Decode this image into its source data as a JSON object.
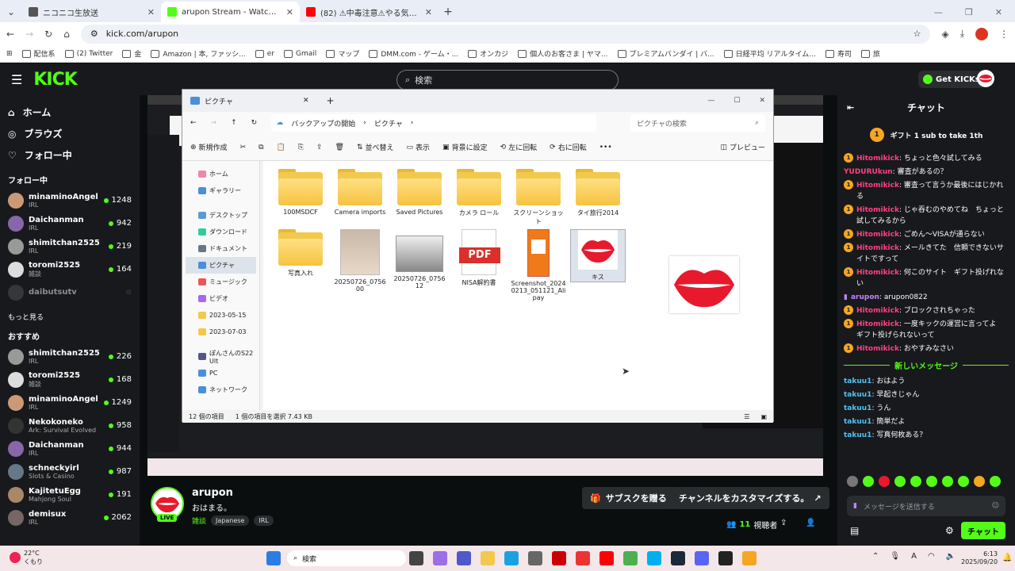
{
  "browser": {
    "tabs": [
      {
        "title": "ニコニコ生放送",
        "color": "#555"
      },
      {
        "title": "arupon Stream - Watch Live on",
        "color": "#53fc18"
      },
      {
        "title": "(82) ⚠中毒注意⚠やる気が⚠",
        "color": "#ff0000"
      }
    ],
    "url": "kick.com/arupon",
    "bookmarks": [
      "配信系",
      "(2) Twitter",
      "金",
      "Amazon | 本, ファッシ...",
      "er",
      "Gmail",
      "マップ",
      "DMM.com - ゲーム・...",
      "オンカジ",
      "個人のお客さま | ヤマ...",
      "プレミアムバンダイ | バ...",
      "日経平均 リアルタイム...",
      "寿司",
      "旅"
    ]
  },
  "kick": {
    "logo": "KICK",
    "search_placeholder": "検索",
    "get_kicks": "Get KICKs"
  },
  "sidebar": {
    "nav": [
      {
        "label": "ホーム",
        "icon": "home-icon"
      },
      {
        "label": "ブラウズ",
        "icon": "compass-icon"
      },
      {
        "label": "フォロー中",
        "icon": "heart-icon"
      }
    ],
    "following_title": "フォロー中",
    "following": [
      {
        "name": "minaminoAngel",
        "cat": "IRL",
        "viewers": "1248",
        "color": "#c97"
      },
      {
        "name": "Daichanman",
        "cat": "IRL",
        "viewers": "942",
        "color": "#86a"
      },
      {
        "name": "shimitchan2525",
        "cat": "IRL",
        "viewers": "219",
        "color": "#999"
      },
      {
        "name": "toromi2525",
        "cat": "雑談",
        "viewers": "164",
        "color": "#ddd"
      },
      {
        "name": "daibutsutv",
        "cat": "",
        "viewers": "",
        "color": "#555"
      }
    ],
    "show_more": "もっと見る",
    "recommended_title": "おすすめ",
    "recommended": [
      {
        "name": "shimitchan2525",
        "cat": "IRL",
        "viewers": "226",
        "color": "#999"
      },
      {
        "name": "toromi2525",
        "cat": "雑談",
        "viewers": "168",
        "color": "#ddd"
      },
      {
        "name": "minaminoAngel",
        "cat": "IRL",
        "viewers": "1249",
        "color": "#c97"
      },
      {
        "name": "Nekokoneko",
        "cat": "Ark: Survival Evolved",
        "viewers": "958",
        "color": "#333"
      },
      {
        "name": "Daichanman",
        "cat": "IRL",
        "viewers": "944",
        "color": "#86a"
      },
      {
        "name": "schneckyirl",
        "cat": "Slots & Casino",
        "viewers": "987",
        "color": "#678"
      },
      {
        "name": "KajitetuEgg",
        "cat": "Mahjong Soul",
        "viewers": "191",
        "color": "#a86"
      },
      {
        "name": "demisux",
        "cat": "IRL",
        "viewers": "2062",
        "color": "#766"
      }
    ]
  },
  "explorer": {
    "title": "ピクチャ",
    "breadcrumb_root": "バックアップの開始",
    "breadcrumb_current": "ピクチャ",
    "search_placeholder": "ピクチャの検索",
    "commands": [
      "新規作成",
      "並べ替え",
      "表示",
      "背景に設定",
      "左に回転",
      "右に回転",
      "プレビュー"
    ],
    "sidebar": [
      {
        "label": "ホーム",
        "color": "#e8a"
      },
      {
        "label": "ギャラリー",
        "color": "#4a8fd8"
      },
      {
        "label": "デスクトップ",
        "color": "#5b9bd5"
      },
      {
        "label": "ダウンロード",
        "color": "#3c9"
      },
      {
        "label": "ドキュメント",
        "color": "#678"
      },
      {
        "label": "ピクチャ",
        "color": "#4a8fd8"
      },
      {
        "label": "ミュージック",
        "color": "#e55"
      },
      {
        "label": "ビデオ",
        "color": "#a6e"
      },
      {
        "label": "2023-05-15",
        "color": "#f2c94c"
      },
      {
        "label": "2023-07-03",
        "color": "#f2c94c"
      },
      {
        "label": "ぽんさんのS22 Ult",
        "color": "#558"
      },
      {
        "label": "PC",
        "color": "#4a8fd8"
      },
      {
        "label": "ネットワーク",
        "color": "#4a8fd8"
      }
    ],
    "items": [
      {
        "name": "100MSDCF",
        "type": "folder"
      },
      {
        "name": "Camera imports",
        "type": "folder"
      },
      {
        "name": "Saved Pictures",
        "type": "folder"
      },
      {
        "name": "カメラ ロール",
        "type": "folder"
      },
      {
        "name": "スクリーンショット",
        "type": "folder"
      },
      {
        "name": "タイ旅行2014",
        "type": "folder"
      },
      {
        "name": "写真入れ",
        "type": "folder"
      },
      {
        "name": "20250726_075600",
        "type": "photo"
      },
      {
        "name": "20250726_075612",
        "type": "photo2"
      },
      {
        "name": "NISA解約書",
        "type": "pdf"
      },
      {
        "name": "Screenshot_20240213_051121_Alipay",
        "type": "phone"
      },
      {
        "name": "キス",
        "type": "lips"
      }
    ],
    "status_count": "12 個の項目",
    "status_selected": "1 個の項目を選択  7.43 KB"
  },
  "chat": {
    "title": "チャット",
    "gift_text": "ギフト 1 sub to take 1th",
    "messages": [
      {
        "user": "Hitomikick",
        "text": "ちょっと色々試してみる",
        "color": "#ff4081",
        "badge": true
      },
      {
        "user": "YUDURUkun",
        "text": "審査があるの？",
        "color": "#ff4081",
        "badge": false
      },
      {
        "user": "Hitomikick",
        "text": "審査って言うか最後にはじかれる",
        "color": "#ff4081",
        "badge": true
      },
      {
        "user": "Hitomikick",
        "text": "じゃ吞むのやめてね　ちょっと試してみるから",
        "color": "#ff4081",
        "badge": true
      },
      {
        "user": "Hitomikick",
        "text": "ごめん〜VISAが通らない",
        "color": "#ff4081",
        "badge": true
      },
      {
        "user": "Hitomikick",
        "text": "メールきてた　信頼できないサイトですって",
        "color": "#ff4081",
        "badge": true
      },
      {
        "user": "Hitomikick",
        "text": "何このサイト　ギフト投げれない",
        "color": "#ff4081",
        "badge": true
      },
      {
        "user": "arupon",
        "text": "arupon0822",
        "color": "#c084fc",
        "badge": false
      },
      {
        "user": "Hitomikick",
        "text": "ブロックされちゃった",
        "color": "#ff4081",
        "badge": true
      },
      {
        "user": "Hitomikick",
        "text": "一度キックの運営に言ってよ　ギフト投げられないって",
        "color": "#ff4081",
        "badge": true
      },
      {
        "user": "Hitomikick",
        "text": "おやすみなさい",
        "color": "#ff4081",
        "badge": true
      }
    ],
    "new_messages_label": "新しいメッセージ",
    "new_messages": [
      {
        "user": "takuu1",
        "text": "おはよう"
      },
      {
        "user": "takuu1",
        "text": "早起きじゃん"
      },
      {
        "user": "takuu1",
        "text": "うん"
      },
      {
        "user": "takuu1",
        "text": "簡単だよ"
      },
      {
        "user": "takuu1",
        "text": "写真何枚ある？"
      }
    ],
    "input_placeholder": "メッセージを送信する",
    "send_label": "チャット"
  },
  "streamer": {
    "name": "arupon",
    "title": "おはまる。",
    "live": "LIVE",
    "tags": [
      "雑談",
      "Japanese",
      "IRL"
    ],
    "sub_button": "サブスクを贈る",
    "customize_button": "チャンネルをカスタマイズする。",
    "viewers": "11",
    "viewers_label": "視聴者"
  },
  "taskbar": {
    "weather_temp": "22°C",
    "weather_desc": "くもり",
    "search": "検索",
    "time": "6:13",
    "date": "2025/09/20"
  }
}
